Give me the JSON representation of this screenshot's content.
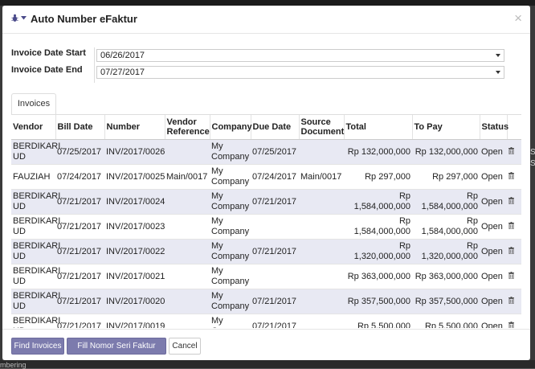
{
  "dialog": {
    "title": "Auto Number eFaktur",
    "close_symbol": "×"
  },
  "form": {
    "start_label": "Invoice Date Start",
    "start_value": "06/26/2017",
    "end_label": "Invoice Date End",
    "end_value": "07/27/2017"
  },
  "tabs": [
    {
      "label": "Invoices"
    }
  ],
  "table": {
    "headers": [
      "Vendor",
      "Bill Date",
      "Number",
      "Vendor Reference",
      "Company",
      "Due Date",
      "Source Document",
      "Total",
      "To Pay",
      "Status"
    ],
    "rows": [
      [
        "BERDIKARI. UD",
        "07/25/2017",
        "INV/2017/0026",
        "",
        "My Company",
        "07/25/2017",
        "",
        "Rp 132,000,000",
        "Rp 132,000,000",
        "Open"
      ],
      [
        "FAUZIAH",
        "07/24/2017",
        "INV/2017/0025",
        "Main/0017",
        "My Company",
        "07/24/2017",
        "Main/0017",
        "Rp 297,000",
        "Rp 297,000",
        "Open"
      ],
      [
        "BERDIKARI. UD",
        "07/21/2017",
        "INV/2017/0024",
        "",
        "My Company",
        "07/21/2017",
        "",
        "Rp 1,584,000,000",
        "Rp 1,584,000,000",
        "Open"
      ],
      [
        "BERDIKARI. UD",
        "07/21/2017",
        "INV/2017/0023",
        "",
        "My Company",
        "",
        "",
        "Rp 1,584,000,000",
        "Rp 1,584,000,000",
        "Open"
      ],
      [
        "BERDIKARI. UD",
        "07/21/2017",
        "INV/2017/0022",
        "",
        "My Company",
        "07/21/2017",
        "",
        "Rp 1,320,000,000",
        "Rp 1,320,000,000",
        "Open"
      ],
      [
        "BERDIKARI. UD",
        "07/21/2017",
        "INV/2017/0021",
        "",
        "My Company",
        "",
        "",
        "Rp 363,000,000",
        "Rp 363,000,000",
        "Open"
      ],
      [
        "BERDIKARI. UD",
        "07/21/2017",
        "INV/2017/0020",
        "",
        "My Company",
        "07/21/2017",
        "",
        "Rp 357,500,000",
        "Rp 357,500,000",
        "Open"
      ],
      [
        "BERDIKARI. UD",
        "07/21/2017",
        "INV/2017/0019",
        "",
        "My Company",
        "07/21/2017",
        "",
        "Rp 5,500,000",
        "Rp 5,500,000",
        "Open"
      ]
    ]
  },
  "buttons": {
    "find": "Find Invoices",
    "fill": "Fill Nomor Seri Faktur Pajak",
    "cancel": "Cancel"
  },
  "background": {
    "right_text": "S\nS",
    "bottom_text": "mbering"
  },
  "colors": {
    "primary": "#7c7bad",
    "row_stripe": "#e8e9f3"
  },
  "icons": {
    "debug": "bug-icon",
    "dropdown": "caret-down-icon",
    "close": "close-icon",
    "delete": "trash-icon"
  }
}
